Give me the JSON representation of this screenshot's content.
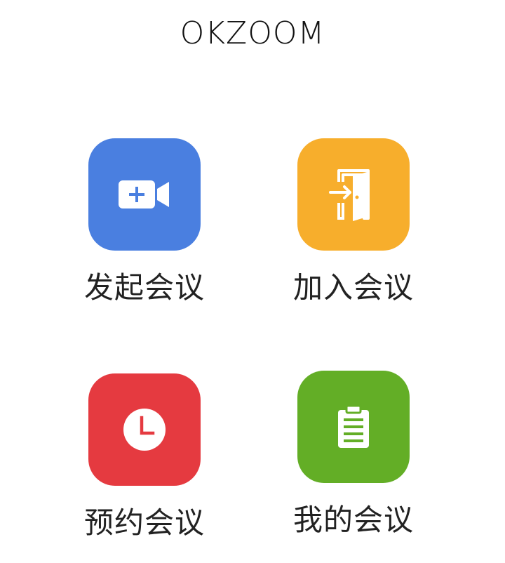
{
  "app": {
    "title": "OKZOOM"
  },
  "tiles": [
    {
      "label": "发起会议",
      "icon": "video-plus-icon",
      "color": "#4A7FE0"
    },
    {
      "label": "加入会议",
      "icon": "enter-door-icon",
      "color": "#F7AE2C"
    },
    {
      "label": "预约会议",
      "icon": "clock-icon",
      "color": "#E53A40"
    },
    {
      "label": "我的会议",
      "icon": "clipboard-list-icon",
      "color": "#63AE26"
    }
  ]
}
